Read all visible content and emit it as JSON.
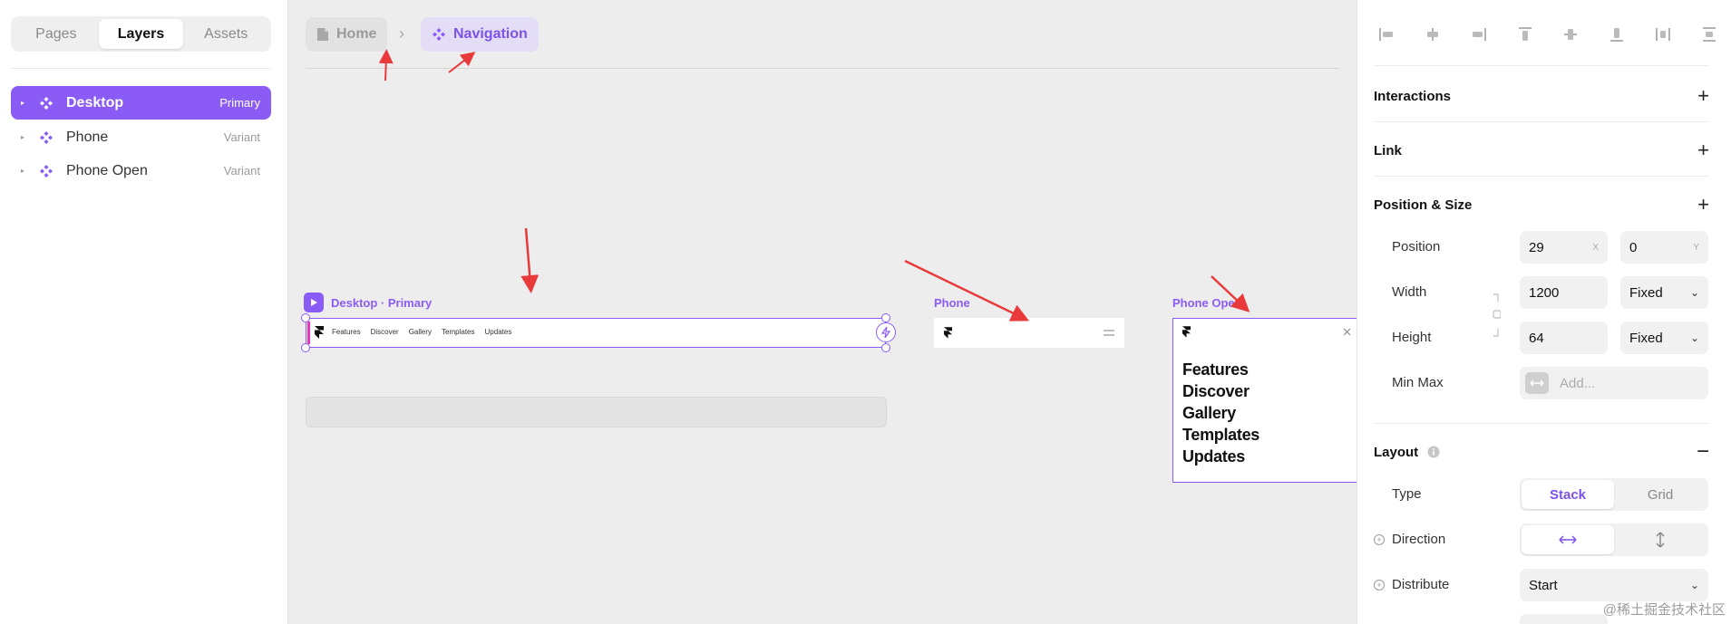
{
  "left_panel": {
    "tabs": [
      "Pages",
      "Layers",
      "Assets"
    ],
    "active_tab": "Layers",
    "layers": [
      {
        "name": "Desktop",
        "tag": "Primary",
        "selected": true
      },
      {
        "name": "Phone",
        "tag": "Variant",
        "selected": false
      },
      {
        "name": "Phone Open",
        "tag": "Variant",
        "selected": false
      }
    ]
  },
  "canvas": {
    "breadcrumb": {
      "home": "Home",
      "current": "Navigation"
    },
    "desktop_frame": {
      "label": "Desktop · Primary",
      "links": [
        "Features",
        "Discover",
        "Gallery",
        "Templates",
        "Updates"
      ]
    },
    "phone_frame": {
      "label": "Phone"
    },
    "phone_open_frame": {
      "label": "Phone Open",
      "links": [
        "Features",
        "Discover",
        "Gallery",
        "Templates",
        "Updates"
      ]
    }
  },
  "right_panel": {
    "interactions": "Interactions",
    "link": "Link",
    "position_size": "Position & Size",
    "position_label": "Position",
    "position_x": "29",
    "position_x_unit": "X",
    "position_y": "0",
    "position_y_unit": "Y",
    "width_label": "Width",
    "width_value": "1200",
    "width_mode": "Fixed",
    "height_label": "Height",
    "height_value": "64",
    "height_mode": "Fixed",
    "minmax_label": "Min Max",
    "minmax_placeholder": "Add...",
    "layout": "Layout",
    "type_label": "Type",
    "type_options": [
      "Stack",
      "Grid"
    ],
    "type_active": "Stack",
    "direction_label": "Direction",
    "distribute_label": "Distribute",
    "distribute_value": "Start"
  },
  "watermark": "@稀土掘金技术社区",
  "colors": {
    "accent": "#8a5cf5",
    "annotation_arrow": "#e83a3a"
  }
}
